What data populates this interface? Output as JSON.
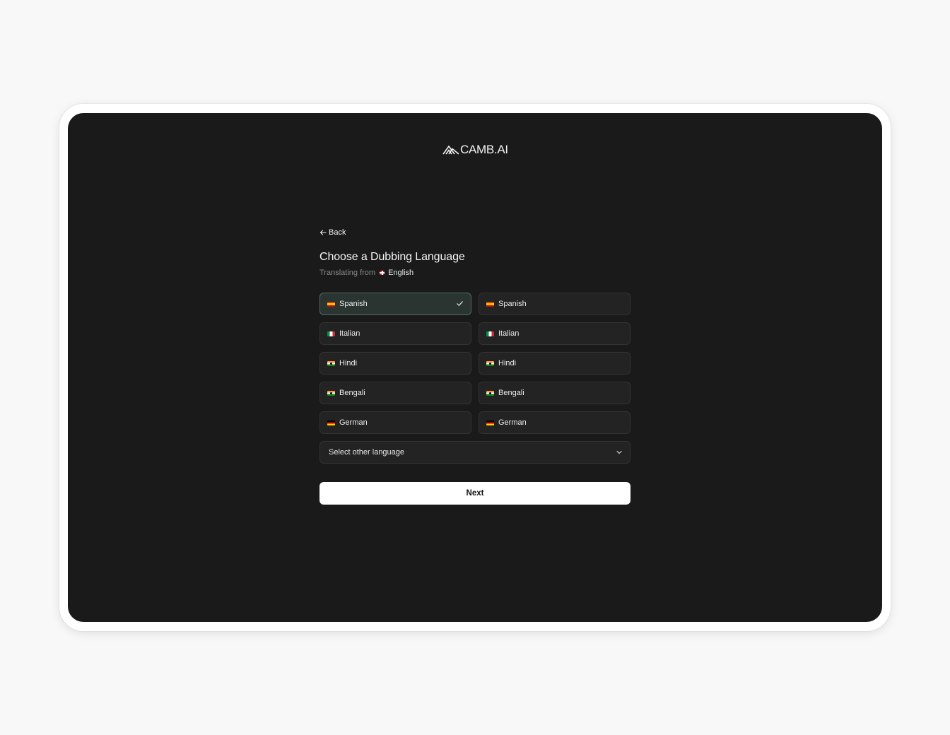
{
  "brand": {
    "name": "CAMB.AI",
    "logo_icon": "camb-mountain-logo-icon"
  },
  "nav": {
    "back_label": "Back",
    "back_icon": "arrow-left-icon"
  },
  "header": {
    "title": "Choose a Dubbing Language",
    "subtitle_prefix": "Translating from",
    "source_language": "English",
    "source_flag": "flag-gb-icon"
  },
  "languages": [
    {
      "label": "Spanish",
      "flag": "flag-es-icon",
      "selected": true
    },
    {
      "label": "Spanish",
      "flag": "flag-es-icon",
      "selected": false
    },
    {
      "label": "Italian",
      "flag": "flag-it-icon",
      "selected": false
    },
    {
      "label": "Italian",
      "flag": "flag-it-icon",
      "selected": false
    },
    {
      "label": "Hindi",
      "flag": "flag-in-icon",
      "selected": false
    },
    {
      "label": "Hindi",
      "flag": "flag-in-icon",
      "selected": false
    },
    {
      "label": "Bengali",
      "flag": "flag-in-icon",
      "selected": false
    },
    {
      "label": "Bengali",
      "flag": "flag-in-icon",
      "selected": false
    },
    {
      "label": "German",
      "flag": "flag-de-icon",
      "selected": false
    },
    {
      "label": "German",
      "flag": "flag-de-icon",
      "selected": false
    }
  ],
  "other_language": {
    "label": "Select other language",
    "icon": "chevron-down-icon"
  },
  "actions": {
    "next_label": "Next"
  },
  "colors": {
    "screen_bg": "#1a1a1a",
    "card_bg": "#232323",
    "selected_bg": "#2a3532",
    "selected_border": "#4f6a5f",
    "primary_button_bg": "#ffffff",
    "page_bg": "#f8f8f8"
  }
}
